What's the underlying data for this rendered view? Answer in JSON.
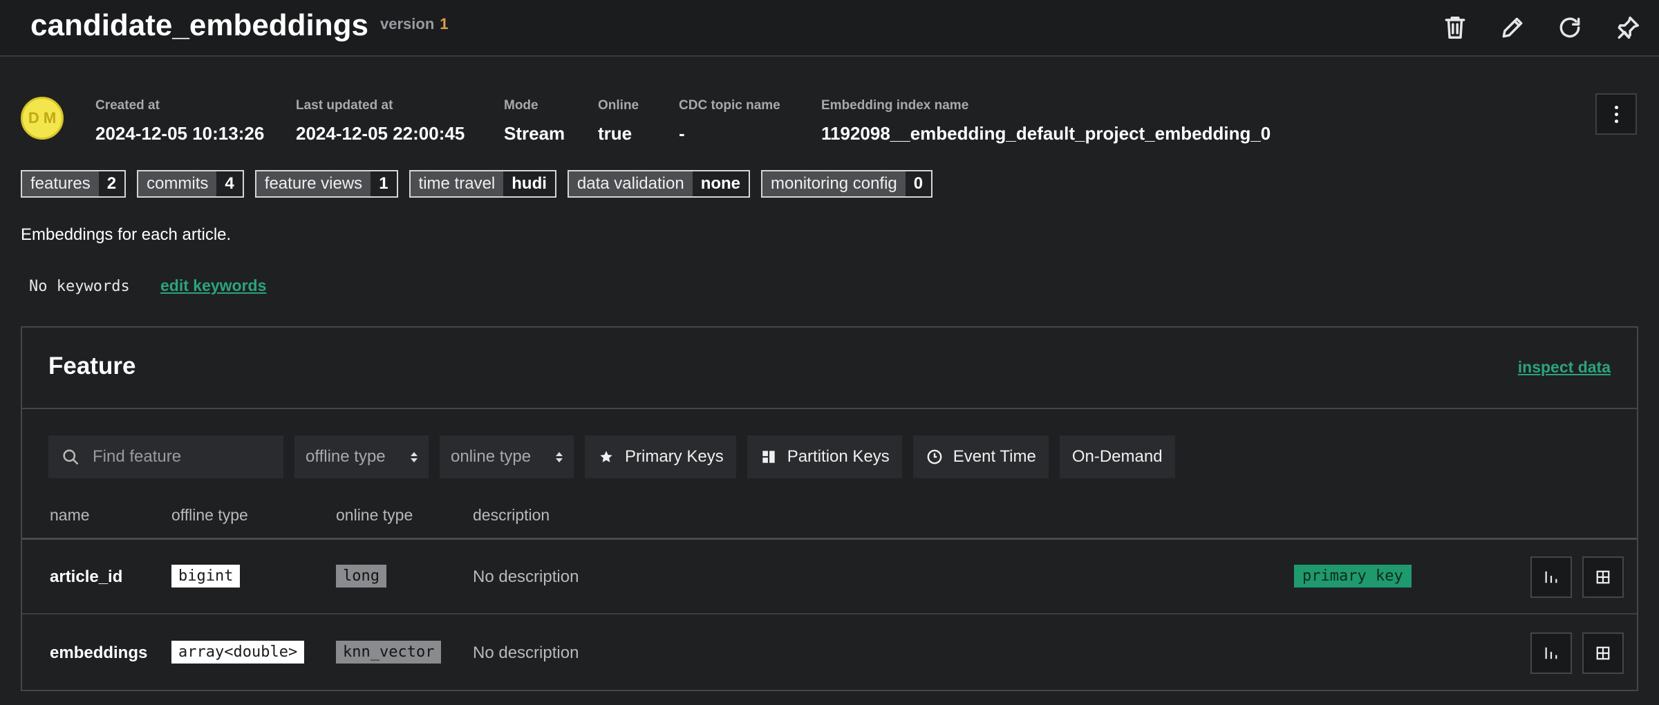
{
  "header": {
    "title": "candidate_embeddings",
    "version_label": "version",
    "version_number": "1",
    "icons": [
      "trash-icon",
      "pencil-icon",
      "refresh-icon",
      "pin-icon"
    ]
  },
  "avatar": {
    "initials": "D M"
  },
  "meta": [
    {
      "label": "Created at",
      "value": "2024-12-05 10:13:26"
    },
    {
      "label": "Last updated at",
      "value": "2024-12-05 22:00:45"
    },
    {
      "label": "Mode",
      "value": "Stream"
    },
    {
      "label": "Online",
      "value": "true"
    },
    {
      "label": "CDC topic name",
      "value": "-"
    },
    {
      "label": "Embedding index name",
      "value": "1192098__embedding_default_project_embedding_0"
    }
  ],
  "badges": [
    {
      "key": "features",
      "value": "2"
    },
    {
      "key": "commits",
      "value": "4"
    },
    {
      "key": "feature views",
      "value": "1"
    },
    {
      "key": "time travel",
      "value": "hudi"
    },
    {
      "key": "data validation",
      "value": "none"
    },
    {
      "key": "monitoring config",
      "value": "0"
    }
  ],
  "description": "Embeddings for each article.",
  "keywords": {
    "empty_text": "No keywords",
    "edit_link": "edit keywords"
  },
  "feature_panel": {
    "title": "Feature",
    "inspect_link": "inspect data",
    "search_placeholder": "Find feature",
    "offline_type_filter": "offline type",
    "online_type_filter": "online type",
    "filter_buttons": [
      "Primary Keys",
      "Partition Keys",
      "Event Time",
      "On-Demand"
    ],
    "columns": [
      "name",
      "offline type",
      "online type",
      "description"
    ],
    "rows": [
      {
        "name": "article_id",
        "offline_type": "bigint",
        "online_type": "long",
        "description": "No description",
        "badge": "primary key"
      },
      {
        "name": "embeddings",
        "offline_type": "array<double>",
        "online_type": "knn_vector",
        "description": "No description",
        "badge": ""
      }
    ]
  },
  "colors": {
    "accent": "#2aa57a",
    "version": "#e0a04a",
    "avatar": "#f3e64d",
    "background": "#1f2022"
  }
}
